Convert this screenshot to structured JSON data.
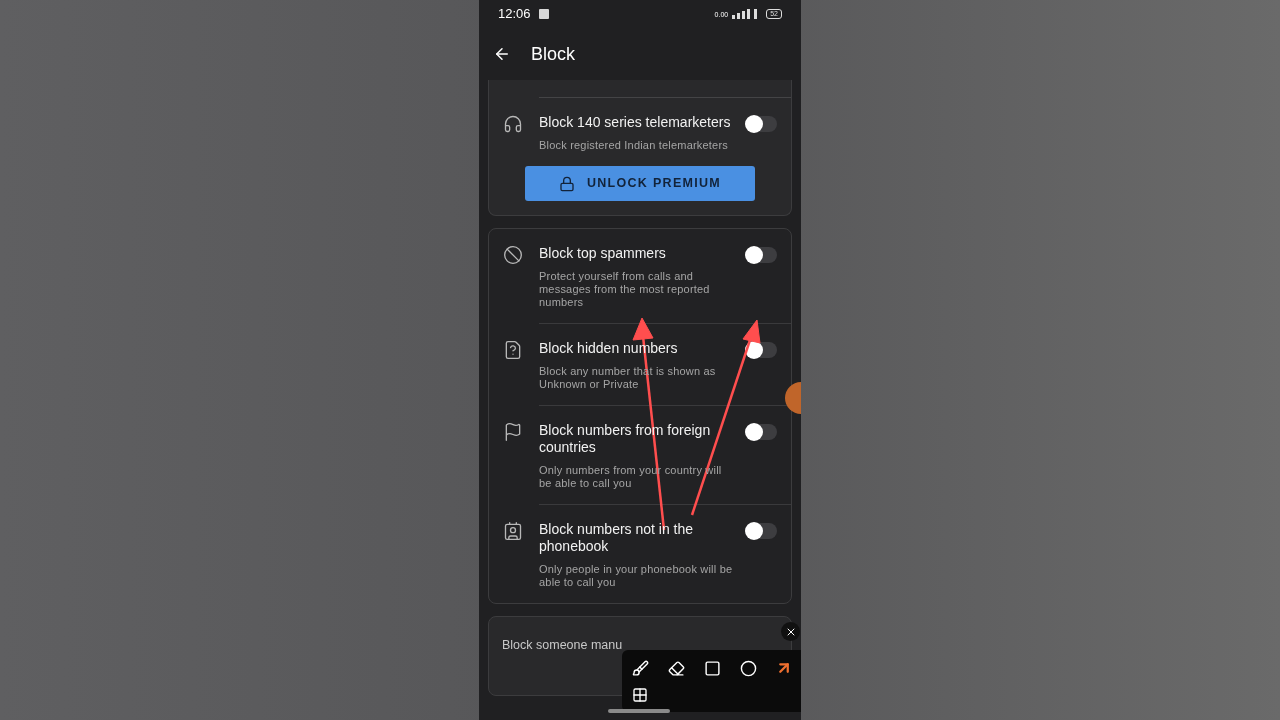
{
  "status_bar": {
    "time": "12:06",
    "speed": "0.00",
    "battery": "52"
  },
  "header": {
    "title": "Block"
  },
  "premium_card": {
    "items": [
      {
        "title": "Block 140 series telemarketers",
        "subtitle": "Block registered Indian telemarketers",
        "on": false
      }
    ],
    "button": "UNLOCK PREMIUM"
  },
  "settings_card": {
    "items": [
      {
        "title": "Block top spammers",
        "subtitle": "Protect yourself from calls and messages from the most reported numbers",
        "on": false
      },
      {
        "title": "Block hidden numbers",
        "subtitle": "Block any number that is shown as Unknown or Private",
        "on": false
      },
      {
        "title": "Block numbers from foreign countries",
        "subtitle": "Only numbers from your country will be able to call you",
        "on": false
      },
      {
        "title": "Block numbers not in the phonebook",
        "subtitle": "Only people in your phonebook will be able to call you",
        "on": false
      }
    ]
  },
  "manual_card": {
    "title": "Block someone manu"
  }
}
